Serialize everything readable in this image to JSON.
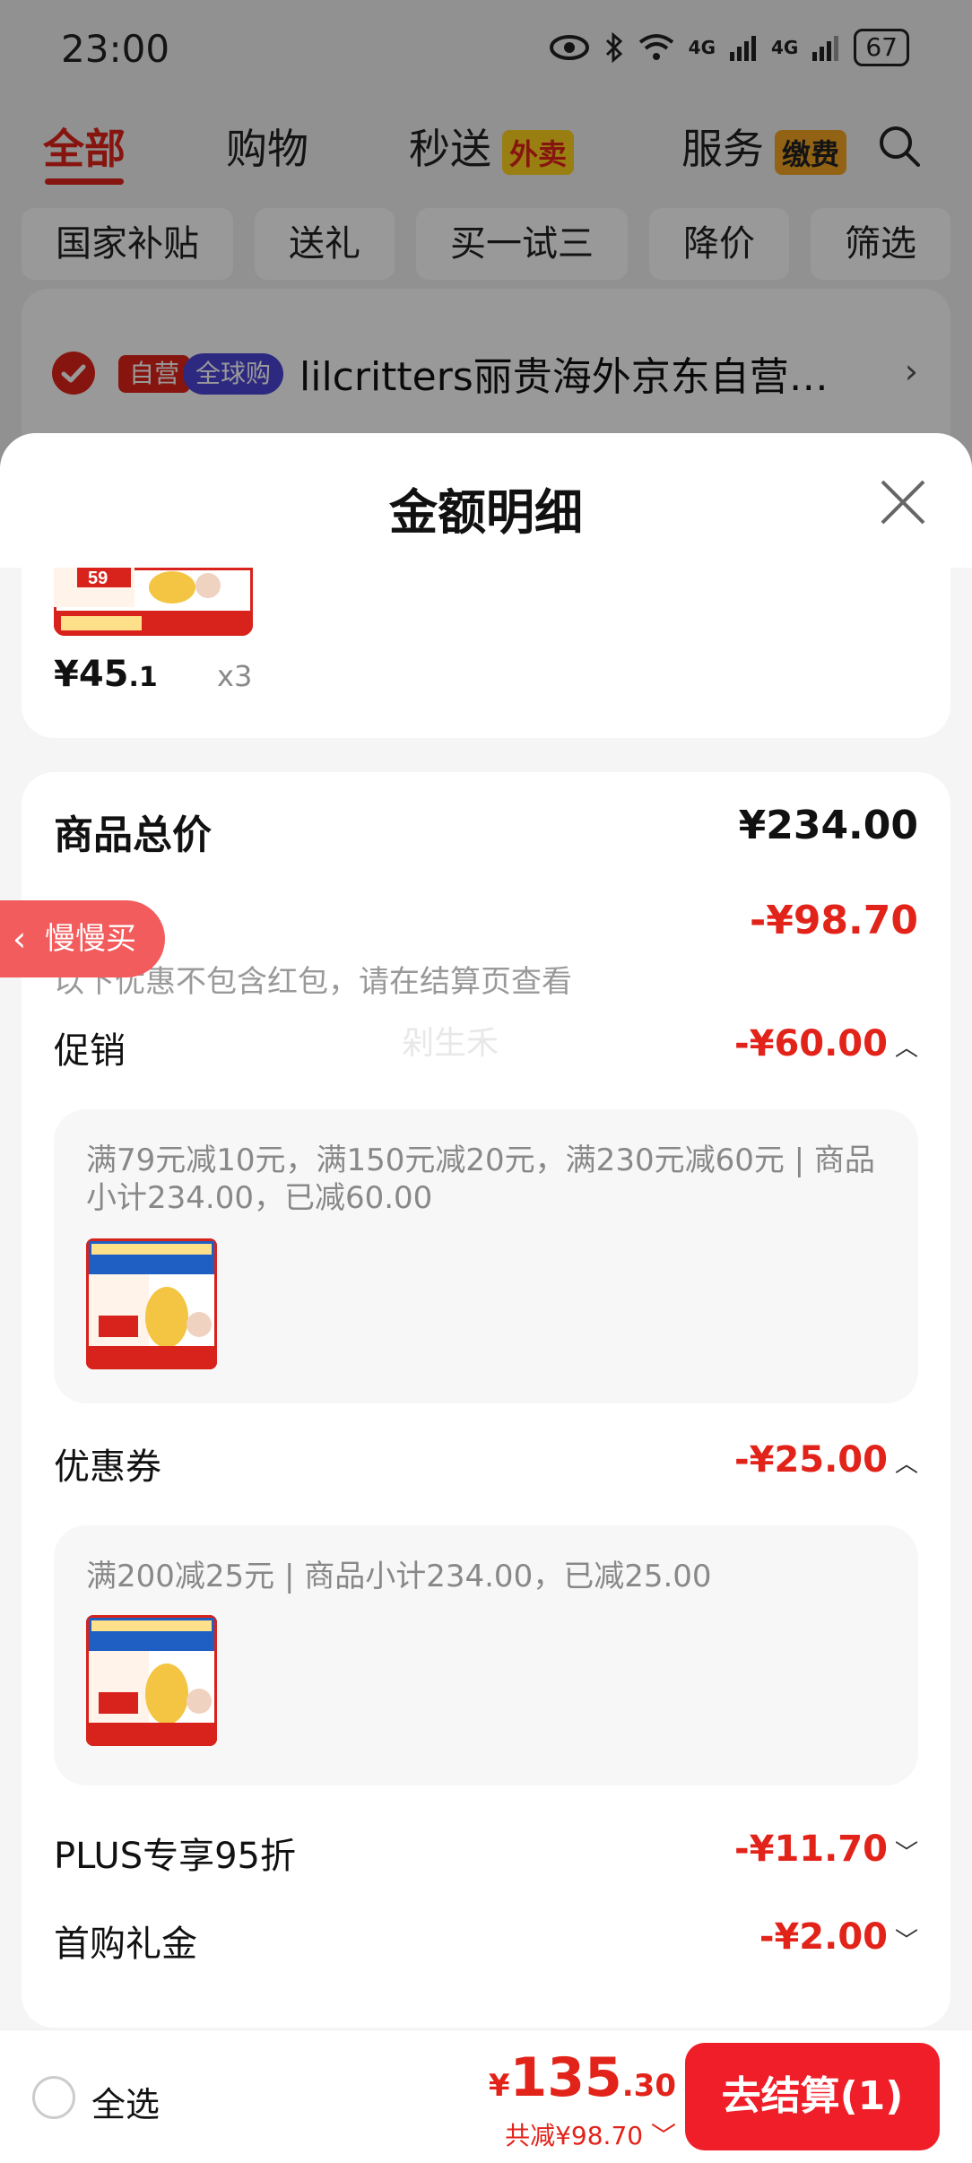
{
  "status_bar": {
    "time": "23:00",
    "battery": "67",
    "network_1": "4G",
    "network_2": "4G"
  },
  "top_tabs": {
    "all": "全部",
    "shopping": "购物",
    "instant": "秒送",
    "instant_badge": "外卖",
    "service": "服务",
    "service_badge": "缴费"
  },
  "filter_chips": [
    "国家补贴",
    "送礼",
    "买一试三",
    "降价",
    "筛选"
  ],
  "shop": {
    "tag_self_run": "自营",
    "tag_global": "全球购",
    "name": "lilcritters丽贵海外京东自营…"
  },
  "sheet": {
    "title": "金额明细"
  },
  "product": {
    "price_int": "¥45",
    "price_dec": ".1",
    "qty": "x3",
    "thumb_price": "59"
  },
  "summary": {
    "total_label": "商品总价",
    "total_value": "¥234.00",
    "discount_label": "共减",
    "discount_value": "-¥98.70",
    "discount_note": "以下优惠不包含红包，请在结算页查看",
    "promo_label": "促销",
    "promo_value": "-¥60.00",
    "promo_detail": "满79元减10元，满150元减20元，满230元减60元 | 商品小计234.00，已减60.00",
    "coupon_label": "优惠券",
    "coupon_value": "-¥25.00",
    "coupon_detail": "满200减25元 | 商品小计234.00，已减25.00",
    "plus_label": "PLUS专享95折",
    "plus_value": "-¥11.70",
    "gift_label": "首购礼金",
    "gift_value": "-¥2.00"
  },
  "float_button": {
    "label": "慢慢买"
  },
  "watermark": "剁生禾",
  "bottom_bar": {
    "select_all": "全选",
    "currency": "¥",
    "price_int": "135",
    "price_dec": ".30",
    "saved_text": "共减¥98.70",
    "checkout": "去结算(1)"
  },
  "colors": {
    "accent": "#e2231a",
    "checkout": "#f01e28",
    "global_tag": "#4b45d6",
    "badge_yellow": "#ffd21e"
  }
}
